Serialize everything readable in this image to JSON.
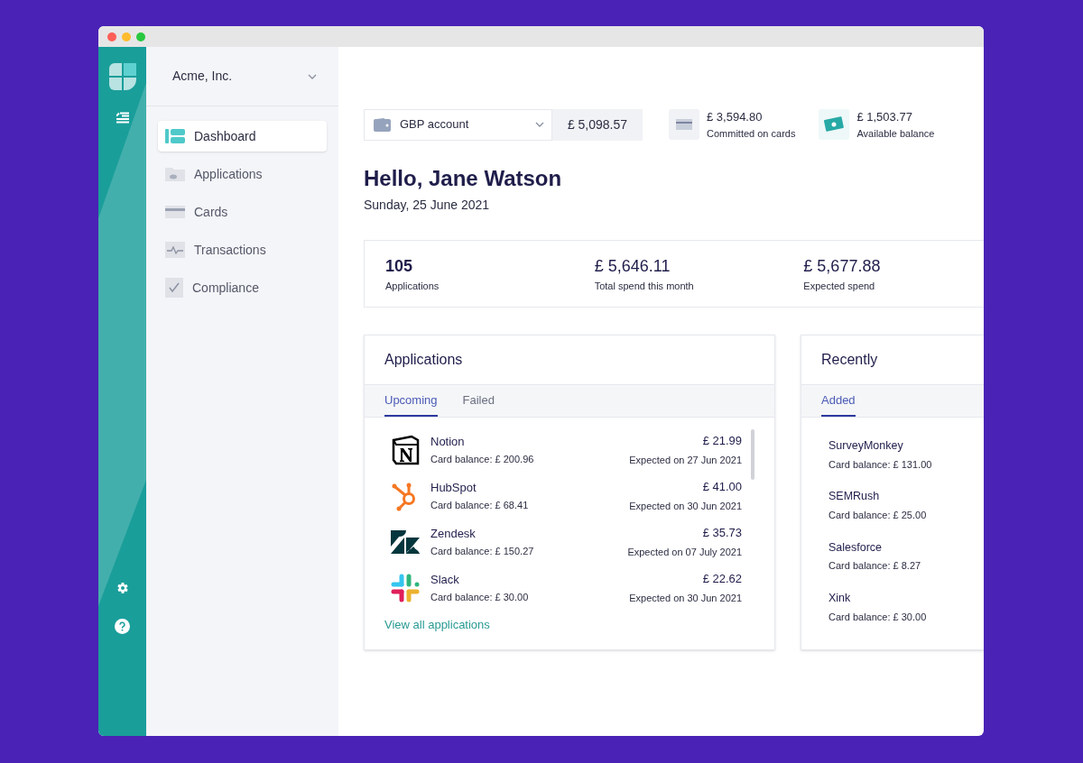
{
  "org": {
    "name": "Acme, Inc."
  },
  "nav": [
    {
      "label": "Dashboard",
      "kind": "dashboard",
      "selected": true
    },
    {
      "label": "Applications",
      "kind": "applications",
      "selected": false
    },
    {
      "label": "Cards",
      "kind": "cards",
      "selected": false
    },
    {
      "label": "Transactions",
      "kind": "transactions",
      "selected": false
    },
    {
      "label": "Compliance",
      "kind": "compliance",
      "selected": false
    }
  ],
  "account": {
    "name": "GBP account",
    "balance": "£ 5,098.57"
  },
  "balances": [
    {
      "kind": "card",
      "amount": "£ 3,594.80",
      "label": "Committed on cards"
    },
    {
      "kind": "cash",
      "amount": "£ 1,503.77",
      "label": "Available balance"
    }
  ],
  "greeting": {
    "title": "Hello, Jane Watson",
    "date": "Sunday, 25 June 2021"
  },
  "stats": [
    {
      "value": "105",
      "label": "Applications"
    },
    {
      "value": "£ 5,646.11",
      "label": "Total spend this month"
    },
    {
      "value": "£ 5,677.88",
      "label": "Expected spend"
    }
  ],
  "applications": {
    "title": "Applications",
    "tabs": [
      {
        "label": "Upcoming",
        "selected": true
      },
      {
        "label": "Failed",
        "selected": false
      }
    ],
    "items": [
      {
        "kind": "notion",
        "name": "Notion",
        "balance": "Card balance: £ 200.96",
        "amount": "£ 21.99",
        "expected": "Expected on 27 Jun 2021"
      },
      {
        "kind": "hubspot",
        "name": "HubSpot",
        "balance": "Card balance: £ 68.41",
        "amount": "£ 41.00",
        "expected": "Expected on 30 Jun 2021"
      },
      {
        "kind": "zendesk",
        "name": "Zendesk",
        "balance": "Card balance: £ 150.27",
        "amount": "£ 35.73",
        "expected": "Expected on 07 July 2021"
      },
      {
        "kind": "slack",
        "name": "Slack",
        "balance": "Card balance: £ 30.00",
        "amount": "£ 22.62",
        "expected": "Expected on 30 Jun 2021"
      }
    ],
    "link": "View all applications"
  },
  "recently": {
    "title": "Recently",
    "tabs": [
      {
        "label": "Added",
        "selected": true
      }
    ],
    "items": [
      {
        "name": "SurveyMonkey",
        "balance": "Card balance: £ 131.00"
      },
      {
        "name": "SEMRush",
        "balance": "Card balance: £ 25.00"
      },
      {
        "name": "Salesforce",
        "balance": "Card balance: £ 8.27"
      },
      {
        "name": "Xink",
        "balance": "Card balance: £ 30.00"
      }
    ]
  }
}
